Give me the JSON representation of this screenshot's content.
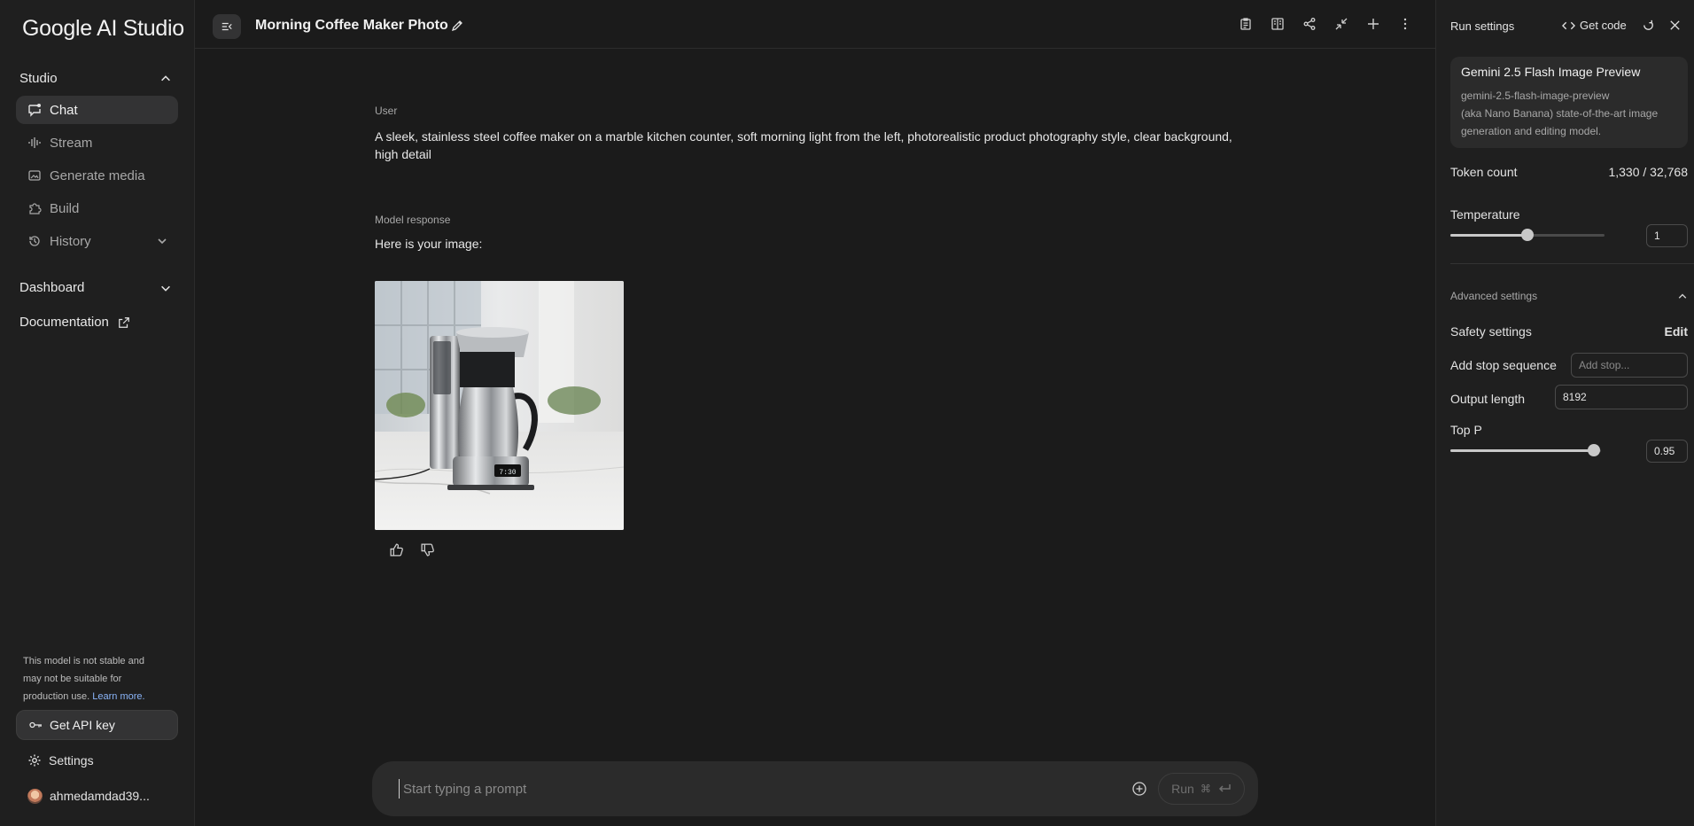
{
  "sidebar": {
    "logo": "Google AI Studio",
    "studio_label": "Studio",
    "items": [
      {
        "label": "Chat",
        "icon": "chat-icon"
      },
      {
        "label": "Stream",
        "icon": "stream-icon"
      },
      {
        "label": "Generate media",
        "icon": "media-icon"
      },
      {
        "label": "Build",
        "icon": "build-icon"
      },
      {
        "label": "History",
        "icon": "history-icon"
      }
    ],
    "dashboard_label": "Dashboard",
    "documentation_label": "Documentation",
    "warning_text": "This model is not stable and may not be suitable for production use.",
    "learn_more": "Learn more.",
    "api_key_label": "Get API key",
    "settings_label": "Settings",
    "user_name": "ahmedamdad39..."
  },
  "header": {
    "title": "Morning Coffee Maker Photo"
  },
  "chat": {
    "user_label": "User",
    "user_prompt": "A sleek, stainless steel coffee maker on a marble kitchen counter, soft morning light from the left, photorealistic product photography style, clear background, high detail",
    "model_label": "Model response",
    "model_text": "Here is your image:",
    "image_display": "7:30"
  },
  "prompt": {
    "placeholder": "Start typing a prompt",
    "run_label": "Run",
    "run_shortcut": "⌘"
  },
  "run_settings": {
    "title": "Run settings",
    "get_code_label": "Get code",
    "model_name": "Gemini 2.5 Flash Image Preview",
    "model_id": "gemini-2.5-flash-image-preview",
    "model_desc": "(aka Nano Banana) state-of-the-art image generation and editing model.",
    "token_count_label": "Token count",
    "token_count_value": "1,330 / 32,768",
    "temperature_label": "Temperature",
    "temperature_value": "1",
    "temperature_fraction": 0.5,
    "advanced_label": "Advanced settings",
    "safety_label": "Safety settings",
    "safety_edit": "Edit",
    "stop_label": "Add stop sequence",
    "stop_placeholder": "Add stop...",
    "output_label": "Output length",
    "output_value": "8192",
    "topp_label": "Top P",
    "topp_value": "0.95",
    "topp_fraction": 0.95
  }
}
